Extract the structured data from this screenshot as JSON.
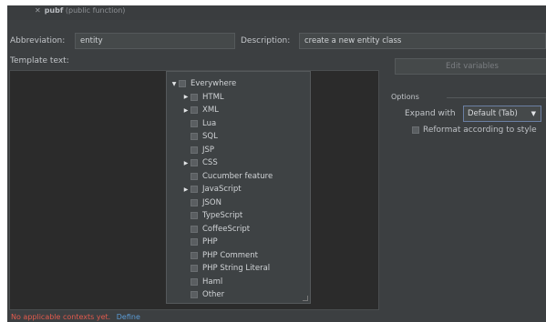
{
  "header": {
    "close_glyph": "✕",
    "template_name": "pubf",
    "template_desc": "(public function)"
  },
  "abbreviation": {
    "label": "Abbreviation:",
    "value": "entity"
  },
  "description": {
    "label": "Description:",
    "value": "create a new entity class"
  },
  "template_text": {
    "label": "Template text:"
  },
  "contexts": {
    "items": [
      {
        "label": "Everywhere",
        "arrow": "▼"
      },
      {
        "label": "HTML",
        "arrow": "▶"
      },
      {
        "label": "XML",
        "arrow": "▶"
      },
      {
        "label": "Lua",
        "arrow": ""
      },
      {
        "label": "SQL",
        "arrow": ""
      },
      {
        "label": "JSP",
        "arrow": ""
      },
      {
        "label": "CSS",
        "arrow": "▶"
      },
      {
        "label": "Cucumber feature",
        "arrow": ""
      },
      {
        "label": "JavaScript",
        "arrow": "▶"
      },
      {
        "label": "JSON",
        "arrow": ""
      },
      {
        "label": "TypeScript",
        "arrow": ""
      },
      {
        "label": "CoffeeScript",
        "arrow": ""
      },
      {
        "label": "PHP",
        "arrow": ""
      },
      {
        "label": "PHP Comment",
        "arrow": ""
      },
      {
        "label": "PHP String Literal",
        "arrow": ""
      },
      {
        "label": "Haml",
        "arrow": ""
      },
      {
        "label": "Other",
        "arrow": ""
      }
    ]
  },
  "edit_variables": {
    "label": "Edit variables"
  },
  "options": {
    "label": "Options",
    "expand_label": "Expand with",
    "expand_value": "Default (Tab)",
    "caret": "▼",
    "reformat_label": "Reformat according to style"
  },
  "footer": {
    "warning": "No applicable contexts yet.",
    "define_link": "Define"
  }
}
